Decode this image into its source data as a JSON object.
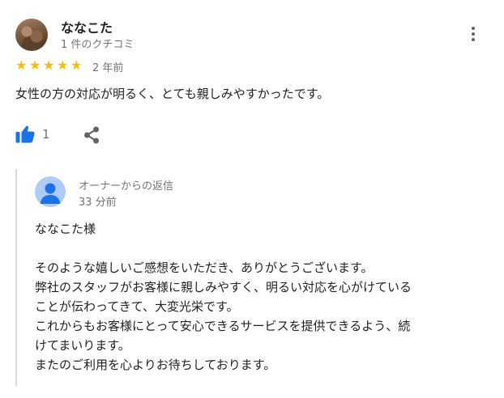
{
  "review": {
    "reviewer_name": "ななこた",
    "review_count": "1 件のクチコミ",
    "rating": 5,
    "time": "2 年前",
    "text": "女性の方の対応が明るく、とても親しみやすかったです。",
    "likes": "1",
    "star_color": "#fbbc04"
  },
  "reply": {
    "label": "オーナーからの返信",
    "time": "33 分前",
    "lines": [
      "ななこた様",
      "",
      "そのような嬉しいご感想をいただき、ありがとうございます。",
      "弊社のスタッフがお客様に親しみやすく、明るい対応を心がけている",
      "ことが伝わってきて、大変光栄です。",
      "これからもお客様にとって安心できるサービスを提供できるよう、続",
      "けてまいります。",
      "またのご利用を心よりお待ちしております。"
    ]
  },
  "icons": {
    "like": "thumbs-up-icon",
    "share": "share-icon",
    "more": "more-vert-icon",
    "accent": "#1a73e8"
  }
}
